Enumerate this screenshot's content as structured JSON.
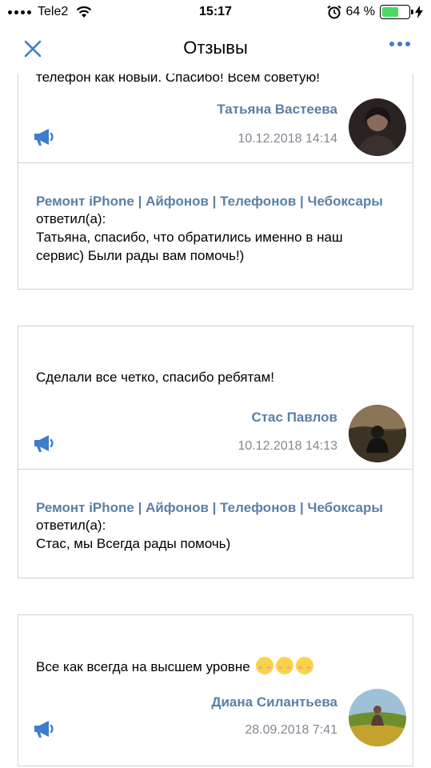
{
  "status_bar": {
    "carrier": "Tele2",
    "time": "15:17",
    "battery": "64 %",
    "battery_level": 0.64,
    "battery_color": "#4cd964"
  },
  "nav": {
    "title": "Отзывы",
    "close_icon": "close-icon",
    "more_icon": "more-dots-icon",
    "accent": "#3c7dcc"
  },
  "cutoff_text": "телефон как новый. Спасибо! Всем советую!",
  "reviews": [
    {
      "text": "",
      "author": "Татьяна Вастеева",
      "date": "10.12.2018 14:14",
      "reply": {
        "company": "Ремонт iPhone | Айфонов | Телефонов | Чебоксары",
        "label": "ответил(а):",
        "lines": [
          "Татьяна, спасибо, что обратились именно в наш",
          "сервис) Были рады вам помочь!)"
        ]
      }
    },
    {
      "text": "Сделали все четко, спасибо ребятам!",
      "author": "Стас Павлов",
      "date": "10.12.2018 14:13",
      "reply": {
        "company": "Ремонт iPhone | Айфонов | Телефонов | Чебоксары",
        "label": "ответил(а):",
        "lines": [
          "Стас, мы Всегда рады помочь)"
        ]
      }
    },
    {
      "text": "Все как всегда на высшем уровне",
      "author": "Диана Силантьева",
      "date": "28.09.2018 7:41"
    }
  ],
  "colors": {
    "link": "#5b7fa8",
    "date": "#828a93",
    "border": "#cfd3d8"
  }
}
